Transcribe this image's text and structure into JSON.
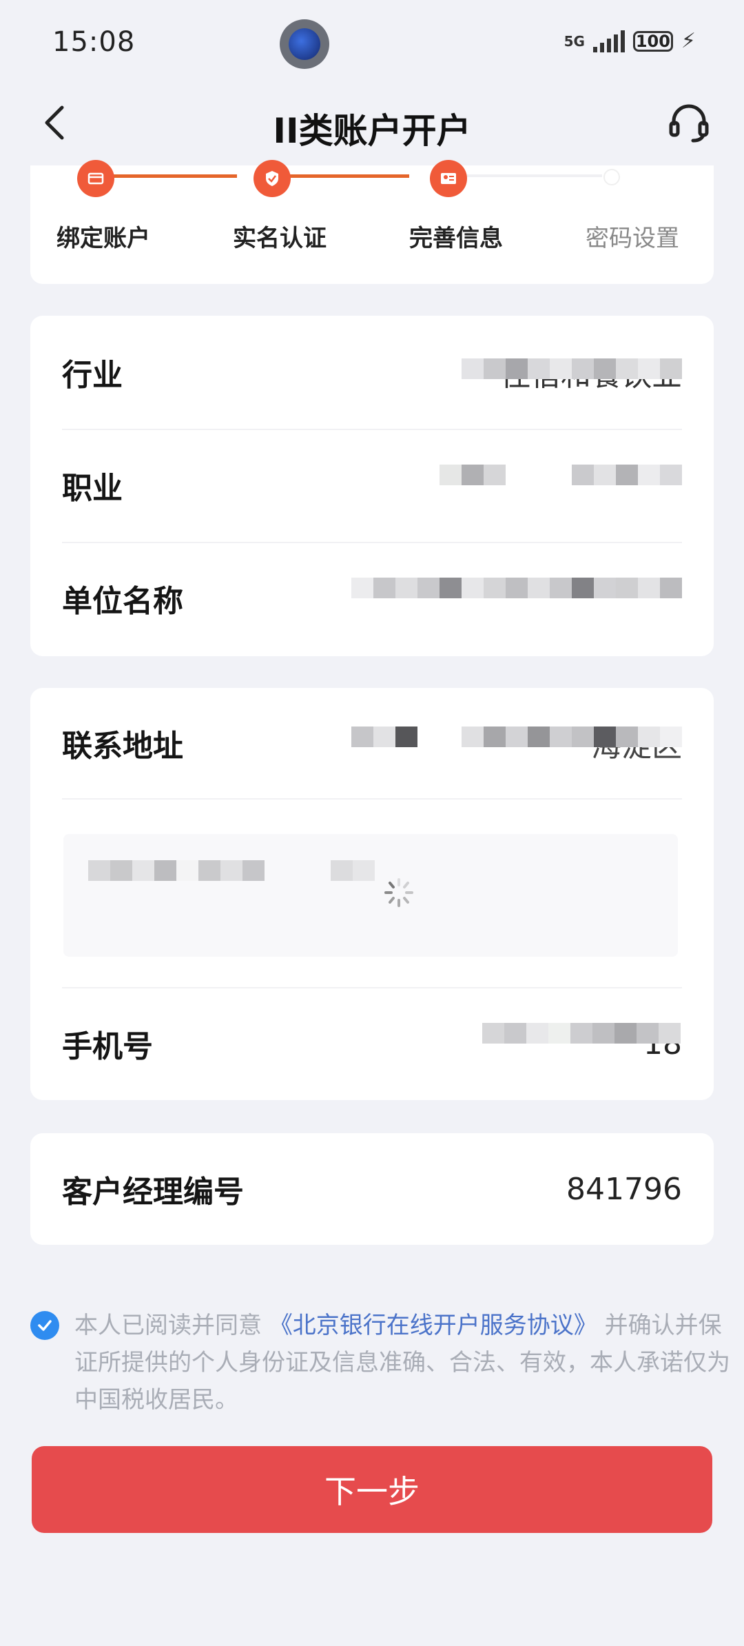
{
  "status_bar": {
    "time": "15:08",
    "network": "5G",
    "battery": "100"
  },
  "nav": {
    "title": "II类账户开户",
    "back_icon": "back-arrow-icon",
    "support_icon": "headset-icon"
  },
  "steps": {
    "items": [
      {
        "label": "绑定账户",
        "status": "done"
      },
      {
        "label": "实名认证",
        "status": "done"
      },
      {
        "label": "完善信息",
        "status": "current"
      },
      {
        "label": "密码设置",
        "status": "pending"
      }
    ]
  },
  "form": {
    "industry": {
      "label": "行业",
      "value": "住宿和餐饮业"
    },
    "occupation": {
      "label": "职业",
      "value": ""
    },
    "employer": {
      "label": "单位名称",
      "value": ""
    },
    "address": {
      "label": "联系地址",
      "value": "海淀区"
    },
    "phone": {
      "label": "手机号",
      "value": "18"
    },
    "manager_id": {
      "label": "客户经理编号",
      "value": "841796"
    }
  },
  "agreement": {
    "checked": true,
    "prefix": "本人已阅读并同意",
    "link": "《北京银行在线开户服务协议》",
    "suffix": "并确认并保证所提供的个人身份证及信息准确、合法、有效，本人承诺仅为中国税收居民。"
  },
  "next_button": {
    "label": "下一步"
  },
  "colors": {
    "accent": "#e64b4d",
    "step_active": "#f05a39",
    "link": "#4b73c9",
    "check": "#2f8cf0"
  }
}
